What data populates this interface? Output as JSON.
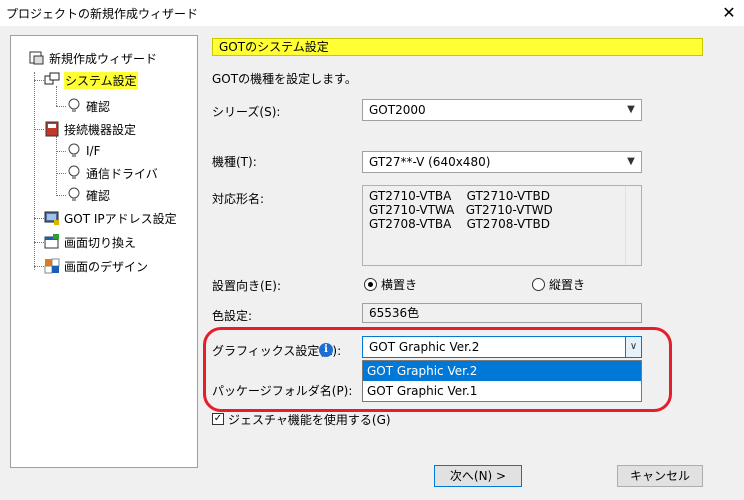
{
  "window": {
    "title": "プロジェクトの新規作成ウィザード",
    "close": "✕"
  },
  "tree": {
    "root": "新規作成ウィザード",
    "system": "システム設定",
    "system_confirm": "確認",
    "device": "接続機器設定",
    "if": "I/F",
    "driver": "通信ドライバ",
    "device_confirm": "確認",
    "got_ip": "GOT IPアドレス設定",
    "screen_switch": "画面切り換え",
    "screen_design": "画面のデザイン"
  },
  "form": {
    "header": "GOTのシステム設定",
    "description": "GOTの機種を設定します。",
    "series_label": "シリーズ(S):",
    "series_value": "GOT2000",
    "model_label": "機種(T):",
    "model_value": "GT27**-V (640x480)",
    "supported_label": "対応形名:",
    "supported_lines": [
      "GT2710-VTBA    GT2710-VTBD",
      "GT2710-VTWA   GT2710-VTWD",
      "GT2708-VTBA    GT2708-VTBD"
    ],
    "orientation_label": "設置向き(E):",
    "horizontal": "横置き",
    "vertical": "縦置き",
    "color_label": "色設定:",
    "color_value": "65536色",
    "graphics_label": "グラフィックス設定(R):",
    "graphics_value": "GOT Graphic Ver.2",
    "graphics_options": [
      "GOT Graphic Ver.2",
      "GOT Graphic Ver.1"
    ],
    "package_label": "パッケージフォルダ名(P):",
    "gesture_label": "ジェスチャ機能を使用する(G)"
  },
  "buttons": {
    "next": "次へ(N) >",
    "cancel": "キャンセル"
  },
  "colors": {
    "highlight_yellow": "#ffff33",
    "selection_blue": "#0078d7",
    "annotation_red": "#e41e2b"
  }
}
